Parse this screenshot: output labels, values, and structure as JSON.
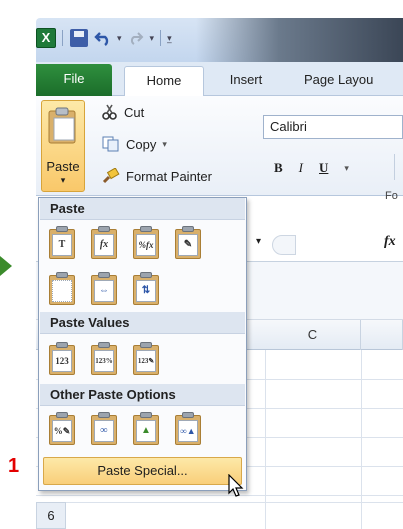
{
  "qat": {
    "icons": [
      "excel-icon",
      "save-icon",
      "undo-icon",
      "redo-icon",
      "customize-icon"
    ]
  },
  "tabs": {
    "file": "File",
    "home": "Home",
    "insert": "Insert",
    "page_layout": "Page Layou"
  },
  "clipboard": {
    "paste_label": "Paste",
    "cut_label": "Cut",
    "copy_label": "Copy",
    "format_painter_label": "Format Painter"
  },
  "font": {
    "name": "Calibri",
    "bold": "B",
    "italic": "I",
    "underline": "U",
    "group_label": "Fo"
  },
  "formula": {
    "fx": "fx"
  },
  "grid": {
    "col_c": "C",
    "row_6": "6"
  },
  "paste_menu": {
    "section_paste": "Paste",
    "section_values": "Paste Values",
    "section_other": "Other Paste Options",
    "paste_special": "Paste Special...",
    "paste_icons": [
      "T",
      "fx",
      "%fx",
      "✎",
      "",
      "⇔",
      "⇅"
    ],
    "values_icons": [
      "123",
      "123%",
      "123✎"
    ],
    "other_icons": [
      "%✎",
      "∞",
      "▲",
      "∞▲"
    ]
  },
  "annotation": {
    "step": "1"
  },
  "colors": {
    "file_tab": "#2f8f3e",
    "highlight": "#f9cf7a",
    "annotation": "#e30000"
  }
}
